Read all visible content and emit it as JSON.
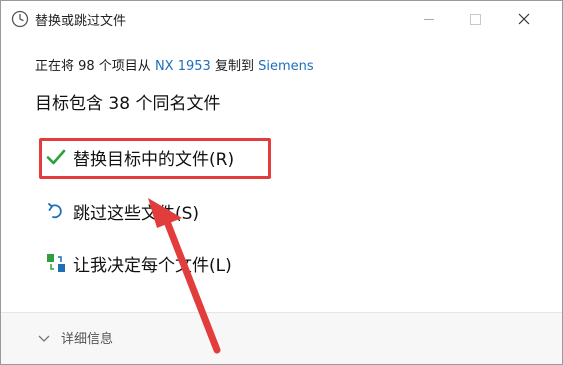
{
  "window": {
    "title": "替换或跳过文件",
    "title_icon": "clock-icon",
    "controls": {
      "minimize": "minimize-icon",
      "maximize": "maximize-icon",
      "close": "close-icon"
    }
  },
  "status": {
    "prefix": "正在将 98 个项目从 ",
    "source": "NX 1953",
    "middle": " 复制到 ",
    "destination": "Siemens",
    "link_color": "#1e6fb8"
  },
  "heading": {
    "prefix": "目标包含 ",
    "count": "38",
    "suffix": " 个同名文件"
  },
  "options": [
    {
      "label": "替换目标中的文件(R)",
      "icon": "checkmark-icon",
      "icon_color": "#2e9e3e"
    },
    {
      "label": "跳过这些文件(S)",
      "icon": "undo-icon",
      "icon_color": "#1e6fb8"
    },
    {
      "label": "让我决定每个文件(L)",
      "icon": "compare-files-icon",
      "icon_color": "#2e9e3e"
    }
  ],
  "highlight_color": "#e23c3c",
  "footer": {
    "details_label": "详细信息",
    "details_icon": "chevron-down-icon"
  },
  "annotation": {
    "arrow_icon": "red-arrow-icon",
    "arrow_color": "#e23c3c"
  }
}
